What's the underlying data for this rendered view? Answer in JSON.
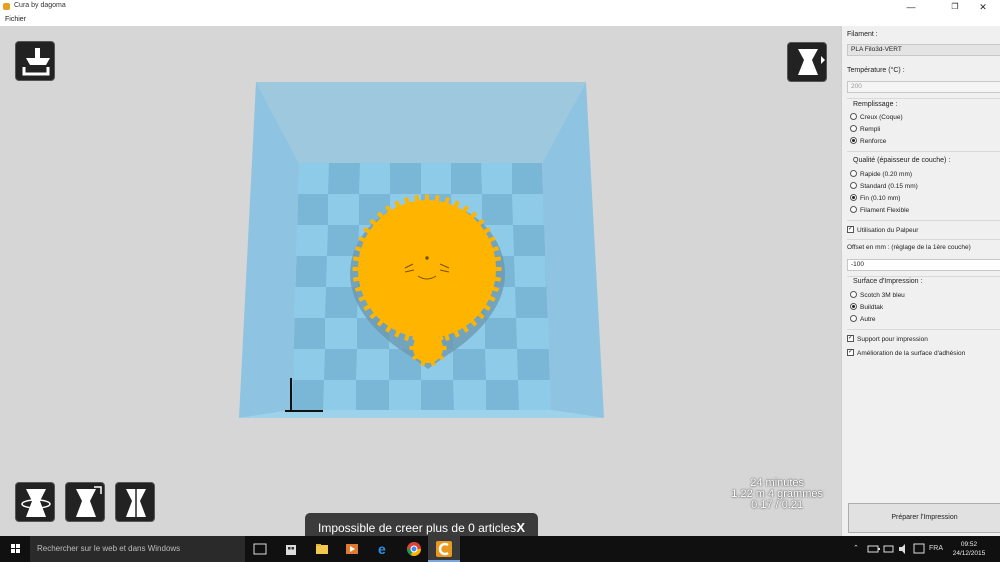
{
  "window": {
    "title": "Cura by dagoma",
    "minimize": "—",
    "restore": "❐",
    "close": "✕"
  },
  "menu": {
    "file": "Fichier"
  },
  "viewport": {
    "stats": {
      "time": "24 minutes",
      "material": "1.22 m 4 grammes",
      "ratio": "0.17 / 0.21"
    },
    "toast": {
      "message": "Impossible de creer plus de 0 articles",
      "close": "X"
    },
    "colors": {
      "bed": "#8ec9e6",
      "model": "#ffb400",
      "background": "#d6d6d6"
    }
  },
  "panel": {
    "filament_label": "Filament :",
    "filament_value": "PLA Filo3d-VERT",
    "temperature_label": "Température (°C) :",
    "temperature_value": "200",
    "infill": {
      "title": "Remplissage :",
      "options": [
        {
          "label": "Creux (Coque)",
          "selected": false
        },
        {
          "label": "Rempli",
          "selected": false
        },
        {
          "label": "Renforce",
          "selected": true
        }
      ]
    },
    "quality": {
      "title": "Qualité (épaisseur de couche) :",
      "options": [
        {
          "label": "Rapide (0.20 mm)",
          "selected": false
        },
        {
          "label": "Standard (0.15 mm)",
          "selected": false
        },
        {
          "label": "Fin (0.10 mm)",
          "selected": true
        },
        {
          "label": "Filament Flexible",
          "selected": false
        }
      ]
    },
    "sensor_label": "Utilisation du Palpeur",
    "sensor_checked": true,
    "offset_label": "Offset en mm : (réglage de la 1ère couche)",
    "offset_value": "-100",
    "surface": {
      "title": "Surface d'Impression :",
      "options": [
        {
          "label": "Scotch 3M bleu",
          "selected": false
        },
        {
          "label": "Buildtak",
          "selected": true
        },
        {
          "label": "Autre",
          "selected": false
        }
      ]
    },
    "support_label": "Support pour impression",
    "support_checked": true,
    "adhesion_label": "Amélioration de la surface d'adhésion",
    "adhesion_checked": true,
    "prepare_button": "Préparer l'Impression"
  },
  "taskbar": {
    "search_placeholder": "Rechercher sur le web et dans Windows",
    "language": "FRA",
    "time": "09:52",
    "date": "24/12/2015"
  }
}
